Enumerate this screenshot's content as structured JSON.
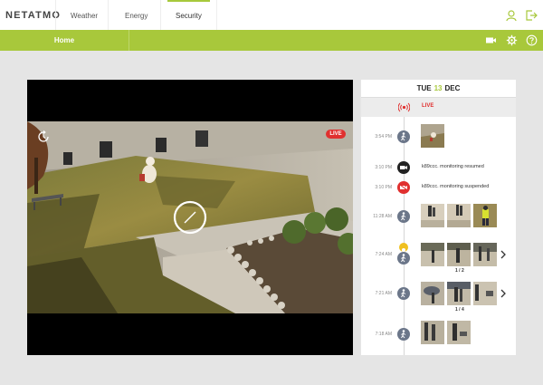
{
  "header": {
    "logo": "NETATMO",
    "tabs": [
      {
        "label": "Weather"
      },
      {
        "label": "Energy"
      },
      {
        "label": "Security"
      }
    ],
    "accent_color": "#a8c83b"
  },
  "subnav": {
    "home_label": "Home"
  },
  "video": {
    "live_badge": "LIVE"
  },
  "timeline": {
    "date": {
      "day": "TUE",
      "num": "13",
      "month": "DEC"
    },
    "live_label": "LIVE",
    "events": [
      {
        "time": "3:54 PM",
        "icon": "person-icon",
        "text": ""
      },
      {
        "time": "3:10 PM",
        "icon": "camera-icon",
        "text": "k89ccc. monitoring resumed"
      },
      {
        "time": "3:10 PM",
        "icon": "camera-off-icon",
        "text": "k89ccc. monitoring suspended"
      },
      {
        "time": "11:28 AM",
        "icon": "person-icon",
        "text": ""
      },
      {
        "time": "7:24 AM",
        "icon": "person-icon",
        "text": "",
        "pager": "1 / 2"
      },
      {
        "time": "7:21 AM",
        "icon": "person-icon",
        "text": "",
        "pager": "1 / 4"
      },
      {
        "time": "7:18 AM",
        "icon": "person-icon",
        "text": ""
      }
    ]
  }
}
